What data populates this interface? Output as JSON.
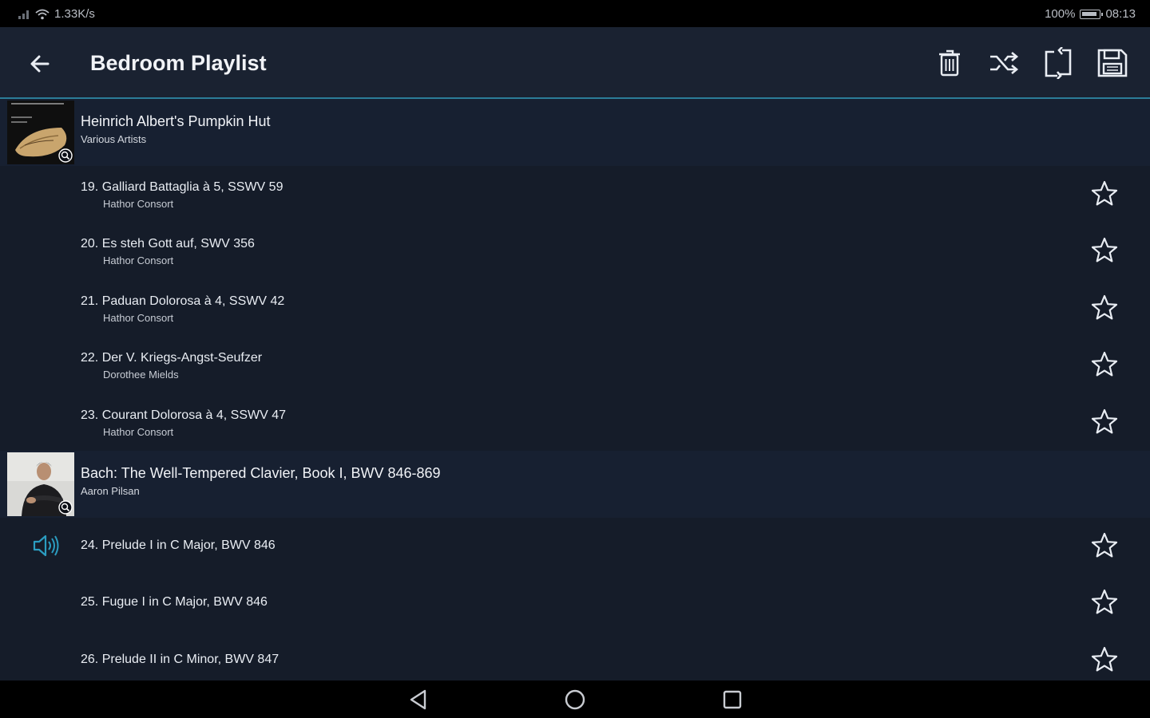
{
  "status_bar": {
    "network_speed": "1.33K/s",
    "battery_percent": "100%",
    "time": "08:13",
    "battery_level": 1.0
  },
  "app_bar": {
    "back_icon": "arrow-left-icon",
    "title": "Bedroom Playlist",
    "actions": [
      "trash-icon",
      "shuffle-icon",
      "crop-rotate-icon",
      "save-icon"
    ]
  },
  "albums": [
    {
      "title": "Heinrich Albert's Pumpkin Hut",
      "artist": "Various Artists",
      "tracks": [
        {
          "title": "19. Galliard Battaglia à 5, SSWV 59",
          "artist": "Hathor Consort"
        },
        {
          "title": "20. Es steh Gott auf, SWV 356",
          "artist": "Hathor Consort"
        },
        {
          "title": "21. Paduan Dolorosa à 4, SSWV 42",
          "artist": "Hathor Consort"
        },
        {
          "title": "22. Der V. Kriegs-Angst-Seufzer",
          "artist": "Dorothee Mields"
        },
        {
          "title": "23. Courant Dolorosa à 4, SSWV 47",
          "artist": "Hathor Consort"
        }
      ]
    },
    {
      "title": "Bach: The Well-Tempered Clavier, Book I, BWV 846-869",
      "artist": "Aaron Pilsan",
      "tracks": [
        {
          "title": "24. Prelude I in C Major, BWV 846",
          "artist": ""
        },
        {
          "title": "25. Fugue I in C Major, BWV 846",
          "artist": ""
        },
        {
          "title": "26. Prelude II in C Minor, BWV 847",
          "artist": ""
        }
      ]
    }
  ],
  "colors": {
    "background": "#151c29",
    "accent": "#2b9cc0",
    "app_bar": "#1a2231"
  },
  "nav_bar": [
    "back-triangle-icon",
    "home-circle-icon",
    "recents-square-icon"
  ]
}
